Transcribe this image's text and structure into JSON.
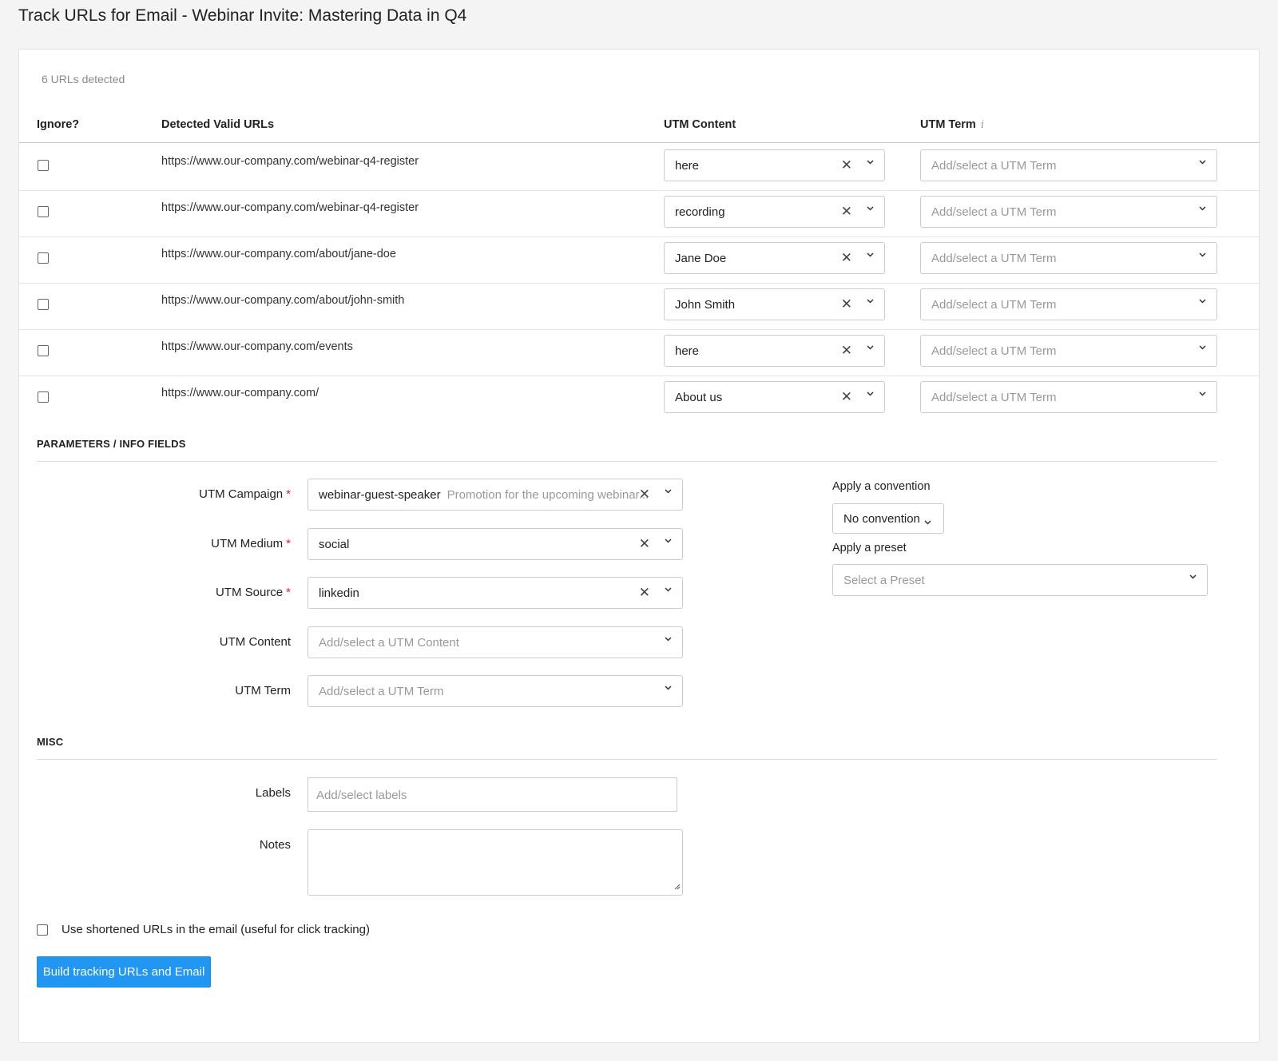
{
  "page": {
    "title": "Track URLs for Email - Webinar Invite: Mastering Data in Q4"
  },
  "summary": {
    "detected": "6 URLs detected"
  },
  "table": {
    "headers": {
      "ignore": "Ignore?",
      "urls": "Detected Valid URLs",
      "utm_content": "UTM Content",
      "utm_term": "UTM Term",
      "info_icon": "i"
    },
    "term_placeholder": "Add/select a UTM Term",
    "rows": [
      {
        "url": "https://www.our-company.com/webinar-q4-register",
        "utm_content": "here"
      },
      {
        "url": "https://www.our-company.com/webinar-q4-register",
        "utm_content": "recording"
      },
      {
        "url": "https://www.our-company.com/about/jane-doe",
        "utm_content": "Jane Doe"
      },
      {
        "url": "https://www.our-company.com/about/john-smith",
        "utm_content": "John Smith"
      },
      {
        "url": "https://www.our-company.com/events",
        "utm_content": "here"
      },
      {
        "url": "https://www.our-company.com/",
        "utm_content": "About us"
      }
    ]
  },
  "params": {
    "section_title": "PARAMETERS / INFO FIELDS",
    "required_mark": "*",
    "campaign": {
      "label": "UTM Campaign",
      "value": "webinar-guest-speaker",
      "description": "Promotion for the upcoming webinar..."
    },
    "medium": {
      "label": "UTM Medium",
      "value": "social"
    },
    "source": {
      "label": "UTM Source",
      "value": "linkedin"
    },
    "content": {
      "label": "UTM Content",
      "placeholder": "Add/select a UTM Content"
    },
    "term": {
      "label": "UTM Term",
      "placeholder": "Add/select a UTM Term"
    },
    "convention": {
      "label": "Apply a convention",
      "value": "No convention"
    },
    "preset": {
      "label": "Apply a preset",
      "placeholder": "Select a Preset"
    },
    "clear_symbol": "✕"
  },
  "misc": {
    "section_title": "MISC",
    "labels": {
      "label": "Labels",
      "placeholder": "Add/select labels"
    },
    "notes": {
      "label": "Notes",
      "value": ""
    },
    "shorten": {
      "label": "Use shortened URLs in the email (useful for click tracking)"
    },
    "build_button": "Build tracking URLs and Email"
  },
  "colors": {
    "primary": "#2196f3",
    "required": "#e02020",
    "background": "#f4f4f4"
  },
  "icons": {
    "clear": "close-icon",
    "dropdown": "chevron-down-icon",
    "info": "info-icon",
    "resize": "resize-grip-icon"
  }
}
